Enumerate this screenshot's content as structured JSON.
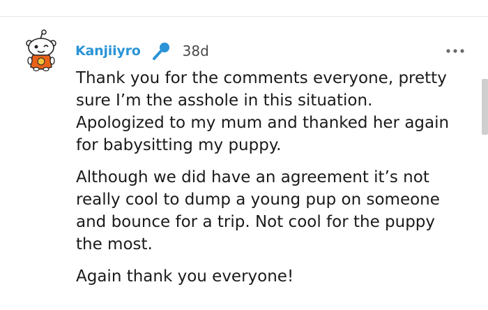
{
  "comment": {
    "author": "Kanjiiyro",
    "age": "38d",
    "paragraphs": [
      "Thank you for the comments everyone, pretty\nsure I’m the asshole in this situation.\nApologized to my mum and thanked her again\nfor babysitting my puppy.",
      "Although we did have an agreement it’s not\nreally cool to dump a young pup on someone\nand bounce for a trip. Not cool for the puppy\nthe most.",
      "Again thank you everyone!"
    ]
  },
  "icons": {
    "avatar": "snoo-avatar",
    "flair": "microphone-icon",
    "menu": "more-options-icon"
  },
  "colors": {
    "username": "#2a94d6",
    "mic_icon": "#2a94d6",
    "text": "#1a1a1a",
    "timestamp": "#4a4a4a",
    "scrollbar": "#cfcfcf"
  }
}
